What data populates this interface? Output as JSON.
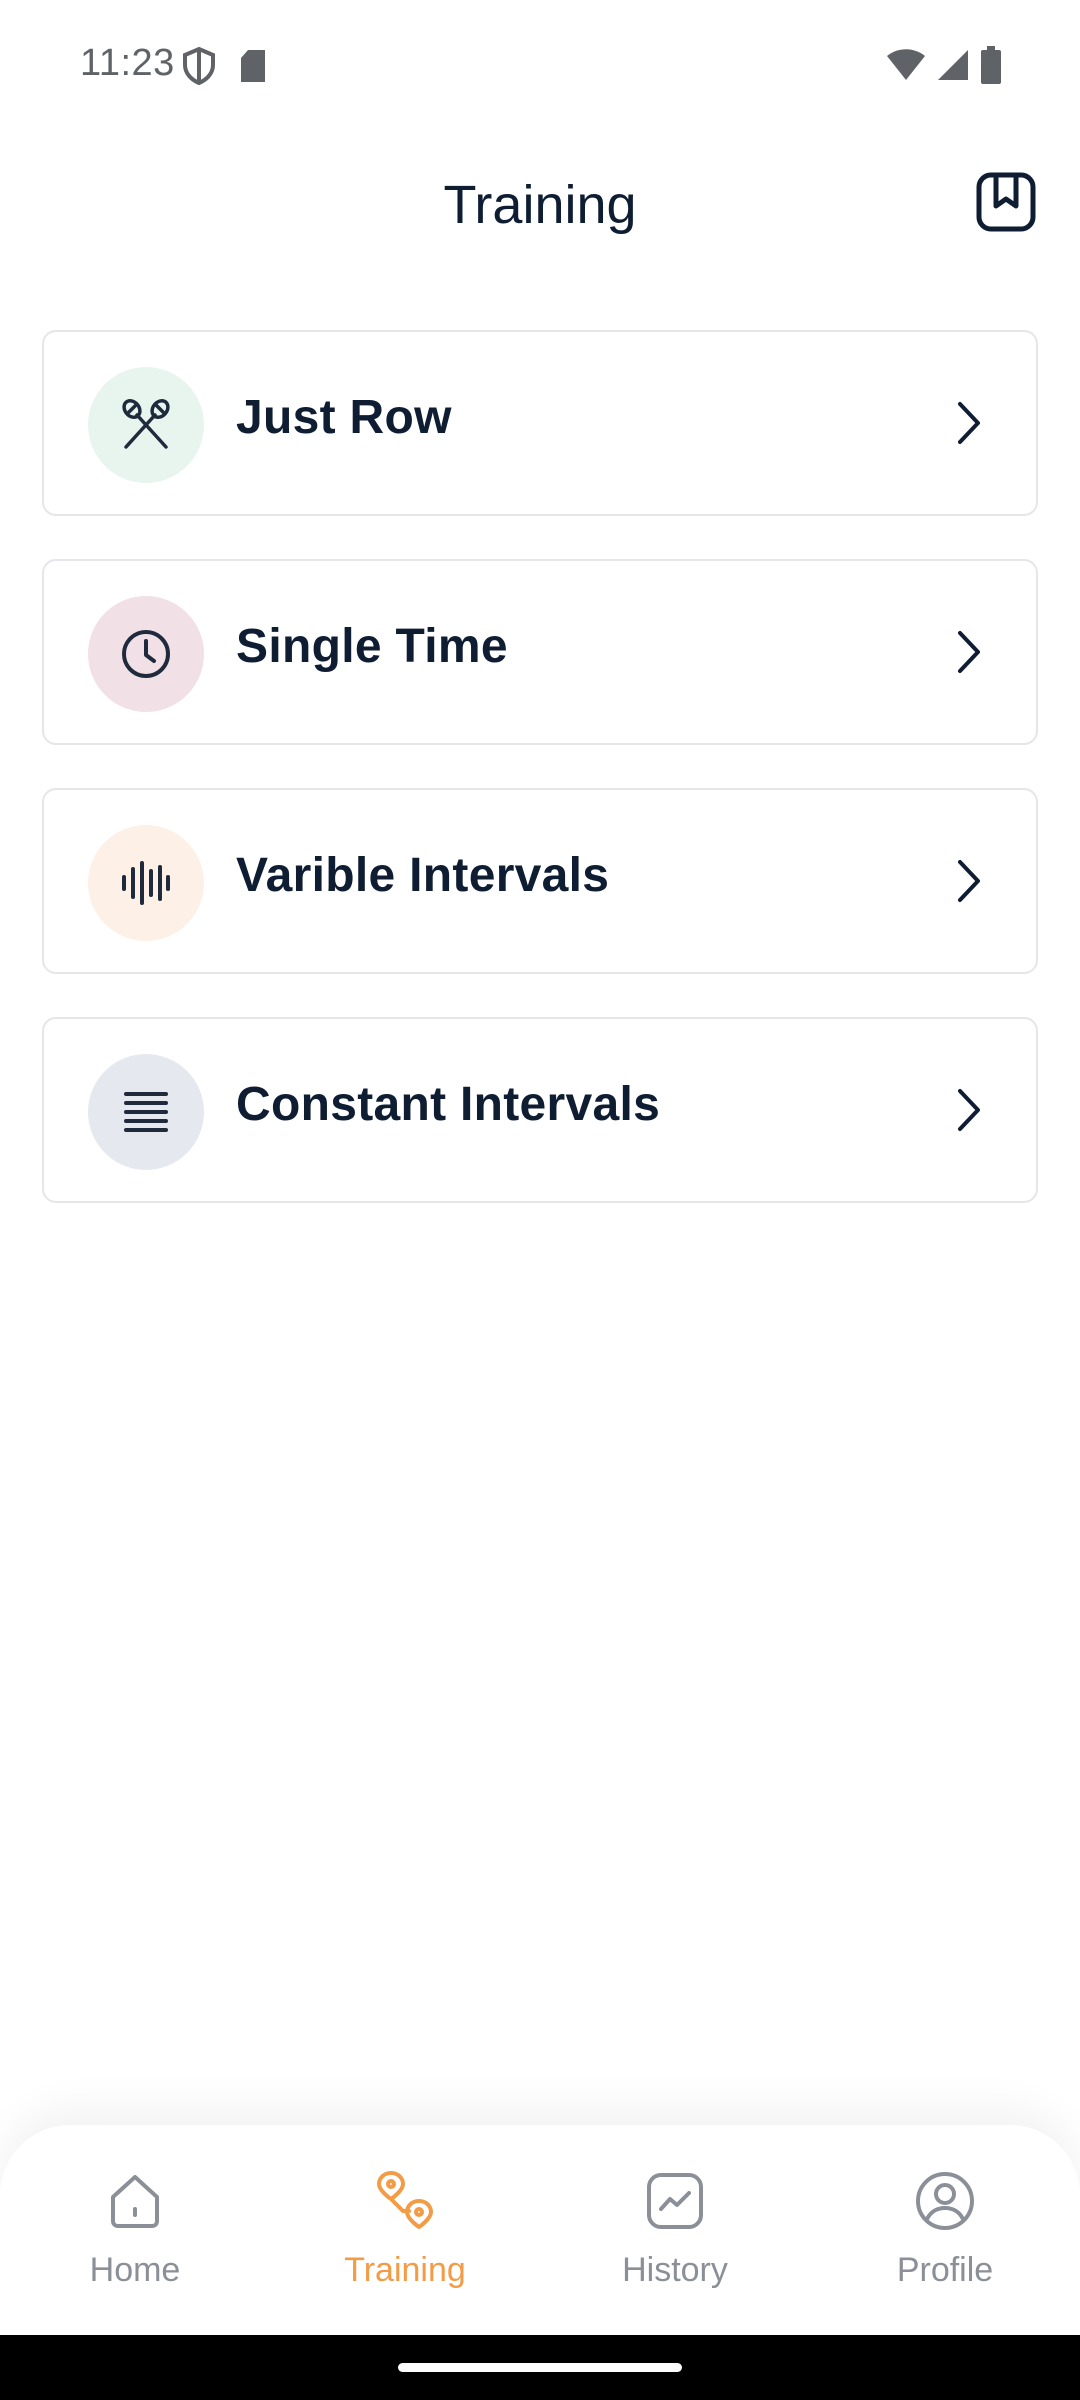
{
  "status_bar": {
    "time": "11:23",
    "icons": [
      "shield-icon",
      "sd-card-icon",
      "wifi-icon",
      "signal-icon",
      "battery-icon"
    ]
  },
  "header": {
    "title": "Training",
    "bookmark_icon": "bookmark-icon"
  },
  "workouts": [
    {
      "label": "Just Row",
      "icon": "oars-icon",
      "icon_bg": "#e8f5ef"
    },
    {
      "label": "Single Time",
      "icon": "clock-icon",
      "icon_bg": "#f1e1e7"
    },
    {
      "label": "Varible Intervals",
      "icon": "waveform-icon",
      "icon_bg": "#fdf0e6"
    },
    {
      "label": "Constant Intervals",
      "icon": "lines-icon",
      "icon_bg": "#e5e8ee"
    }
  ],
  "bottom_nav": {
    "items": [
      {
        "label": "Home",
        "icon": "home-icon",
        "active": false
      },
      {
        "label": "Training",
        "icon": "route-icon",
        "active": true
      },
      {
        "label": "History",
        "icon": "chart-icon",
        "active": false
      },
      {
        "label": "Profile",
        "icon": "user-icon",
        "active": false
      }
    ],
    "active_color": "#f39b45",
    "inactive_color": "#8b8f98"
  }
}
